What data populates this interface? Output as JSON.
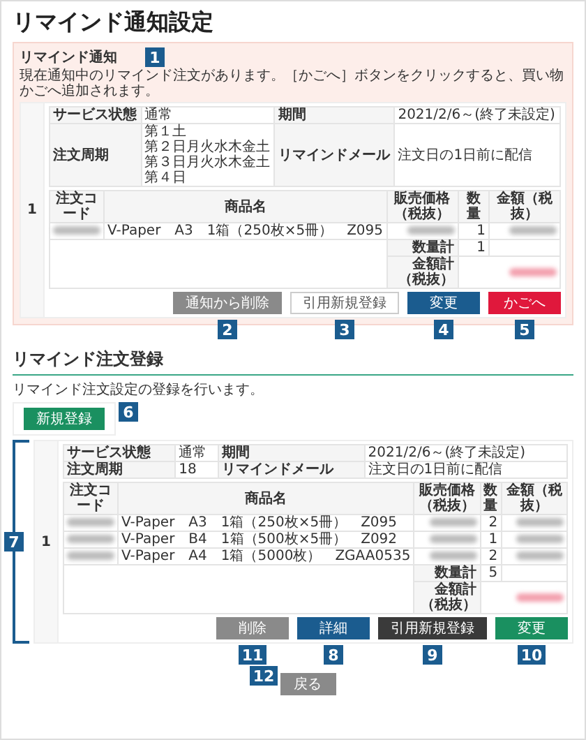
{
  "title": "リマインド通知設定",
  "notice": {
    "label": "リマインド通知",
    "callout": "1",
    "description": "現在通知中のリマインド注文があります。［かごへ］ボタンをクリックすると、買い物かごへ追加されます。",
    "order": {
      "index": "1",
      "info": [
        {
          "label1": "サービス状態",
          "value1": [
            "通常"
          ],
          "label2": "期間",
          "value2": "2021/2/6～(終了未設定)"
        },
        {
          "label1": "注文周期",
          "value1": [
            "第１土",
            "第２日月火水木金土",
            "第３日月火水木金土",
            "第４日"
          ],
          "label2": "リマインドメール",
          "value2": "注文日の1日前に配信"
        }
      ],
      "columns": [
        "注文コード",
        "商品名",
        "販売価格（税抜）",
        "数量",
        "金額（税抜）"
      ],
      "items": [
        {
          "name": "V-Paper　A3　1箱（250枚×5冊）　Z095",
          "quantity": "1"
        }
      ],
      "quantity_total_label": "数量計",
      "quantity_total": "1",
      "amount_total_label": "金額計（税抜）",
      "buttons": [
        {
          "label": "通知から削除",
          "kind": "gray",
          "callout": "2"
        },
        {
          "label": "引用新規登録",
          "kind": "outline",
          "callout": "3"
        },
        {
          "label": "変更",
          "kind": "blue",
          "callout": "4"
        },
        {
          "label": "かごへ",
          "kind": "red",
          "callout": "5"
        }
      ]
    }
  },
  "registration": {
    "heading": "リマインド注文登録",
    "note": "リマインド注文設定の登録を行います。",
    "new_button": {
      "label": "新規登録",
      "callout": "6"
    },
    "order": {
      "index": "1",
      "callout": "7",
      "info": [
        {
          "label1": "サービス状態",
          "value1": [
            "通常"
          ],
          "label2": "期間",
          "value2": "2021/2/6～(終了未設定)"
        },
        {
          "label1": "注文周期",
          "value1": [
            "18"
          ],
          "label2": "リマインドメール",
          "value2": "注文日の1日前に配信"
        }
      ],
      "columns": [
        "注文コード",
        "商品名",
        "販売価格（税抜）",
        "数量",
        "金額（税抜）"
      ],
      "items": [
        {
          "name": "V-Paper　A3　1箱（250枚×5冊）　Z095",
          "quantity": "2"
        },
        {
          "name": "V-Paper　B4　1箱（500枚×5冊）　Z092",
          "quantity": "1"
        },
        {
          "name": "V-Paper　A4　1箱（5000枚）　ZGAA0535",
          "quantity": "2"
        }
      ],
      "quantity_total_label": "数量計",
      "quantity_total": "5",
      "amount_total_label": "金額計（税抜）",
      "buttons": [
        {
          "label": "削除",
          "kind": "gray",
          "callout": "11"
        },
        {
          "label": "詳細",
          "kind": "blue",
          "callout": "8"
        },
        {
          "label": "引用新規登録",
          "kind": "dark",
          "callout": "9"
        },
        {
          "label": "変更",
          "kind": "green",
          "callout": "10"
        }
      ]
    }
  },
  "back_button": {
    "label": "戻る",
    "callout": "12"
  }
}
